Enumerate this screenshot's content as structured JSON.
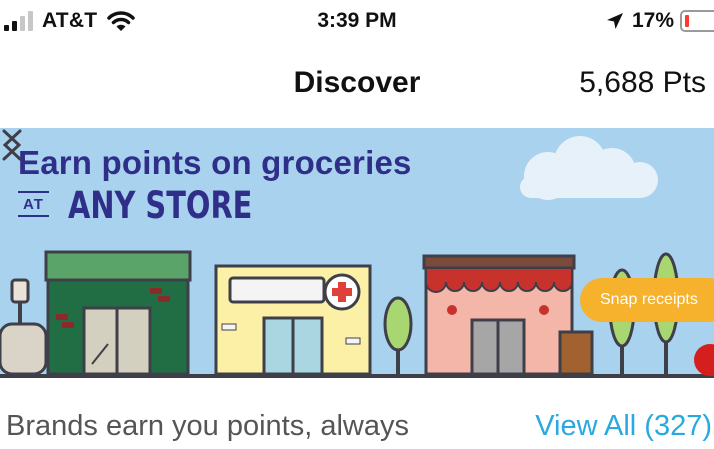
{
  "status_bar": {
    "carrier": "AT&T",
    "time": "3:39 PM",
    "battery": "17%",
    "battery_level": 0.17,
    "icons": [
      "signal-icon",
      "wifi-icon",
      "location-arrow-icon",
      "battery-icon"
    ]
  },
  "header": {
    "title": "Discover",
    "points": "5,688 Pts"
  },
  "banner": {
    "headline": "Earn points on groceries",
    "at_label": "AT",
    "store_label": "ANY STORE",
    "snap_button": "Snap receipts",
    "icons": [
      "chevron-left-icon",
      "chevron-right-icon"
    ]
  },
  "brands_section": {
    "title": "Brands earn you points, always",
    "view_all": "View All (327)"
  },
  "colors": {
    "banner_bg": "#a9d2ee",
    "headline": "#2f2f8a",
    "accent_link": "#2aa8e0",
    "snap_button": "#f6b12d",
    "battery_low": "#ff3b30"
  }
}
